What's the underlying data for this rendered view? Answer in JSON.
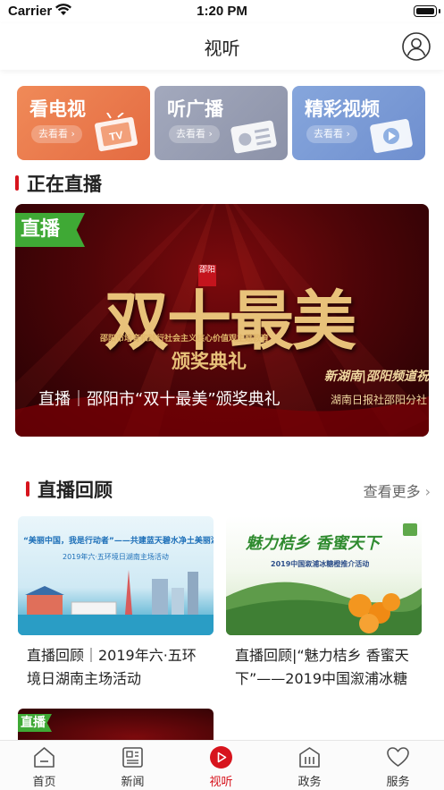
{
  "status_bar": {
    "carrier": "Carrier",
    "time": "1:20 PM"
  },
  "nav": {
    "title": "视听"
  },
  "categories": [
    {
      "title": "看电视",
      "sub": "去看看 ›"
    },
    {
      "title": "听广播",
      "sub": "去看看 ›"
    },
    {
      "title": "精彩视频",
      "sub": "去看看 ›"
    }
  ],
  "live": {
    "section_title": "正在直播",
    "badge": "直播",
    "poster_title": "双十最美",
    "poster_seal": "邵阳",
    "poster_subline": "邵阳市培育和践行社会主义核心价值观主题教育",
    "poster_award": "颁奖典礼",
    "poster_logo": "新湖南|邵阳频道祝",
    "poster_logo2": "湖南日报社邵阳分社",
    "caption": "直播｜邵阳市“双十最美”颁奖典礼"
  },
  "replay": {
    "section_title": "直播回顾",
    "more": "查看更多",
    "items": [
      {
        "title": "直播回顾｜2019年六·五环境日湖南主场活动",
        "thumb_head": "“美丽中国，我是行动者”——共建蓝天碧水净土美丽湖南",
        "thumb_sub": "2019年六·五环境日湖南主场活动"
      },
      {
        "title": "直播回顾|“魅力桔乡 香蜜天下”——2019中国溆浦冰糖橙推介活动",
        "thumb_head": "魅力桔乡 香蜜天下",
        "thumb_sub": "2019中国溆浦冰糖橙推介活动"
      }
    ],
    "peek_badge": "直播"
  },
  "tabs": [
    {
      "label": "首页",
      "icon": "home-icon",
      "active": false
    },
    {
      "label": "新闻",
      "icon": "news-icon",
      "active": false
    },
    {
      "label": "视听",
      "icon": "play-icon",
      "active": true
    },
    {
      "label": "政务",
      "icon": "government-icon",
      "active": false
    },
    {
      "label": "服务",
      "icon": "heart-icon",
      "active": false
    }
  ],
  "colors": {
    "accent": "#d7141d",
    "live_badge": "#3fa935"
  }
}
